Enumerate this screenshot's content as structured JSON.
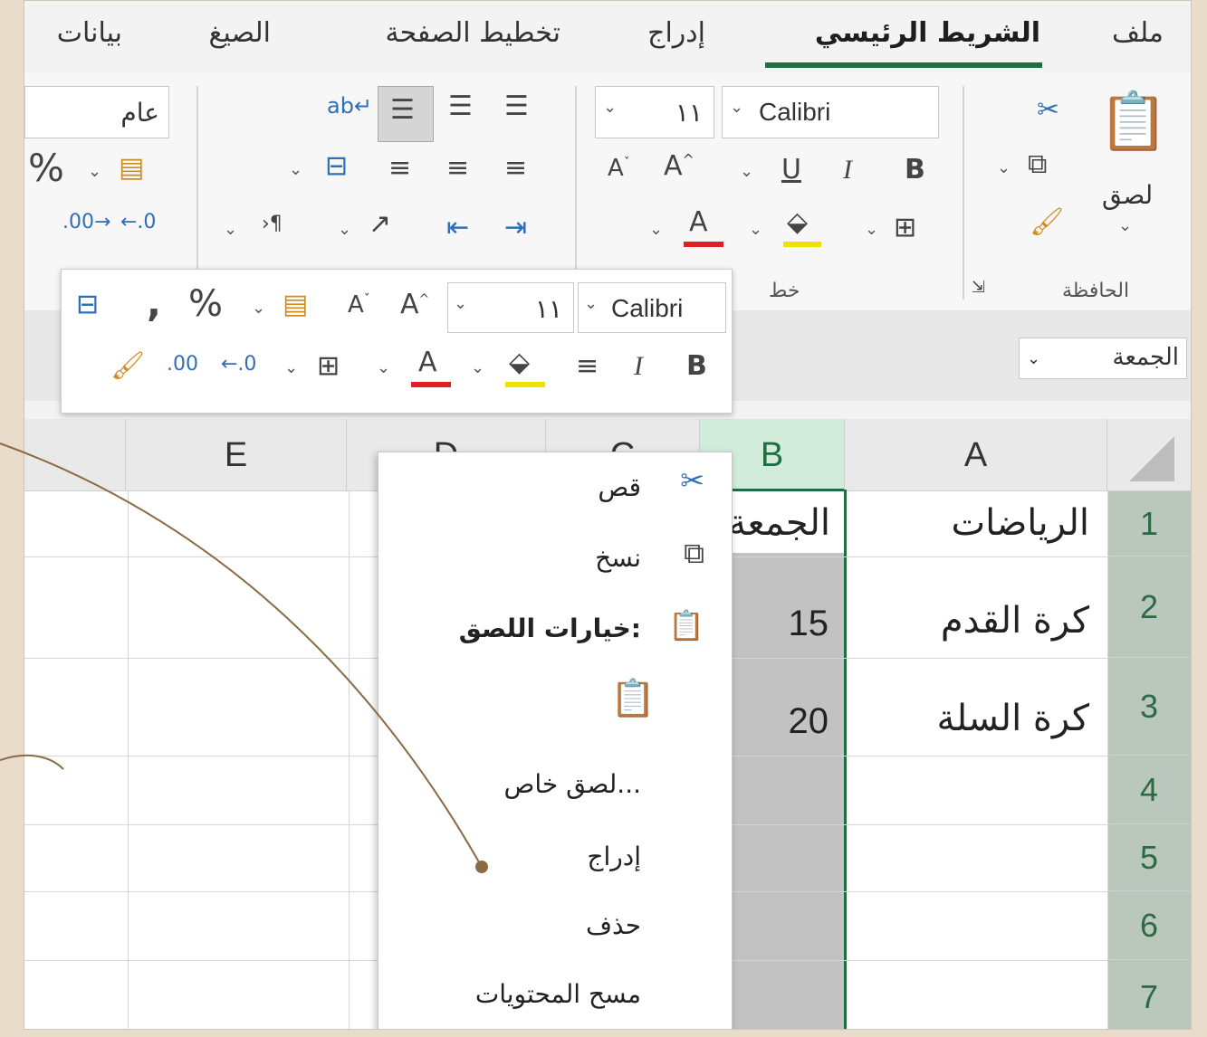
{
  "tabs": {
    "file": "ملف",
    "home": "الشريط الرئيسي",
    "insert": "إدراج",
    "page_layout": "تخطيط الصفحة",
    "formulas": "الصيغ",
    "data": "بيانات"
  },
  "ribbon": {
    "paste_label": "لصق",
    "clipboard_group": "الحافظة",
    "font_name": "Calibri",
    "font_size": "١١",
    "font_group": "خط",
    "number_format": "عام"
  },
  "name_box": "الجمعة",
  "mini_toolbar": {
    "font_name": "Calibri",
    "font_size": "١١"
  },
  "grid": {
    "columns": [
      "A",
      "B",
      "C",
      "D",
      "E"
    ],
    "rows": [
      "1",
      "2",
      "3",
      "4",
      "5",
      "6",
      "7"
    ],
    "cells": {
      "A1": "الرياضات",
      "A2": "كرة القدم",
      "A3": "كرة السلة",
      "B1": "الجمعة",
      "B2": "15",
      "B3": "20"
    }
  },
  "context_menu": {
    "cut": "قص",
    "copy": "نسخ",
    "paste_options": "خيارات اللصق:",
    "paste_special": "لصق خاص...",
    "insert": "إدراج",
    "delete": "حذف",
    "clear_contents": "مسح المحتويات"
  },
  "colors": {
    "accent_green": "#1d6f42",
    "font_color_red": "#e02020",
    "highlight_yellow": "#f0e000",
    "callout_brown": "#8b6a45"
  }
}
